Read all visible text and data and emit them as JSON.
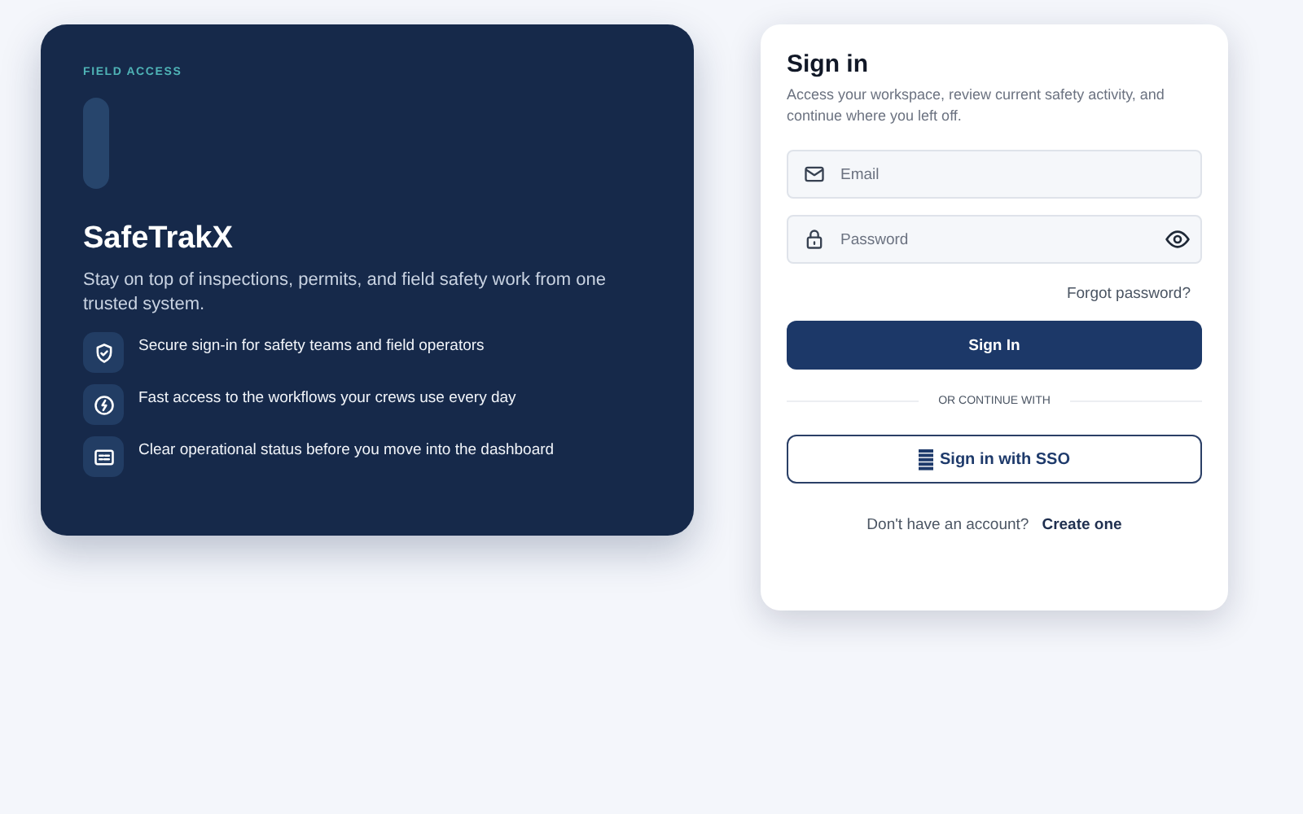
{
  "hero": {
    "eyebrow": "FIELD ACCESS",
    "title": "SafeTrakX",
    "subtitle": "Stay on top of inspections, permits, and field safety work from one trusted system.",
    "features": [
      {
        "kind": "shield",
        "text": "Secure sign-in for safety teams and field operators"
      },
      {
        "kind": "bolt",
        "text": "Fast access to the workflows your crews use every day"
      },
      {
        "kind": "status",
        "text": "Clear operational status before you move into the dashboard"
      }
    ]
  },
  "signin": {
    "title": "Sign in",
    "subtitle": "Access your workspace, review current safety activity, and continue where you left off.",
    "email": {
      "placeholder": "Email"
    },
    "password": {
      "placeholder": "Password"
    },
    "forgot": "Forgot password?",
    "submit": "Sign In",
    "divider": "OR CONTINUE WITH",
    "sso": "Sign in with SSO",
    "signup_prompt": "Don't have an account?",
    "signup_link": "Create one"
  }
}
